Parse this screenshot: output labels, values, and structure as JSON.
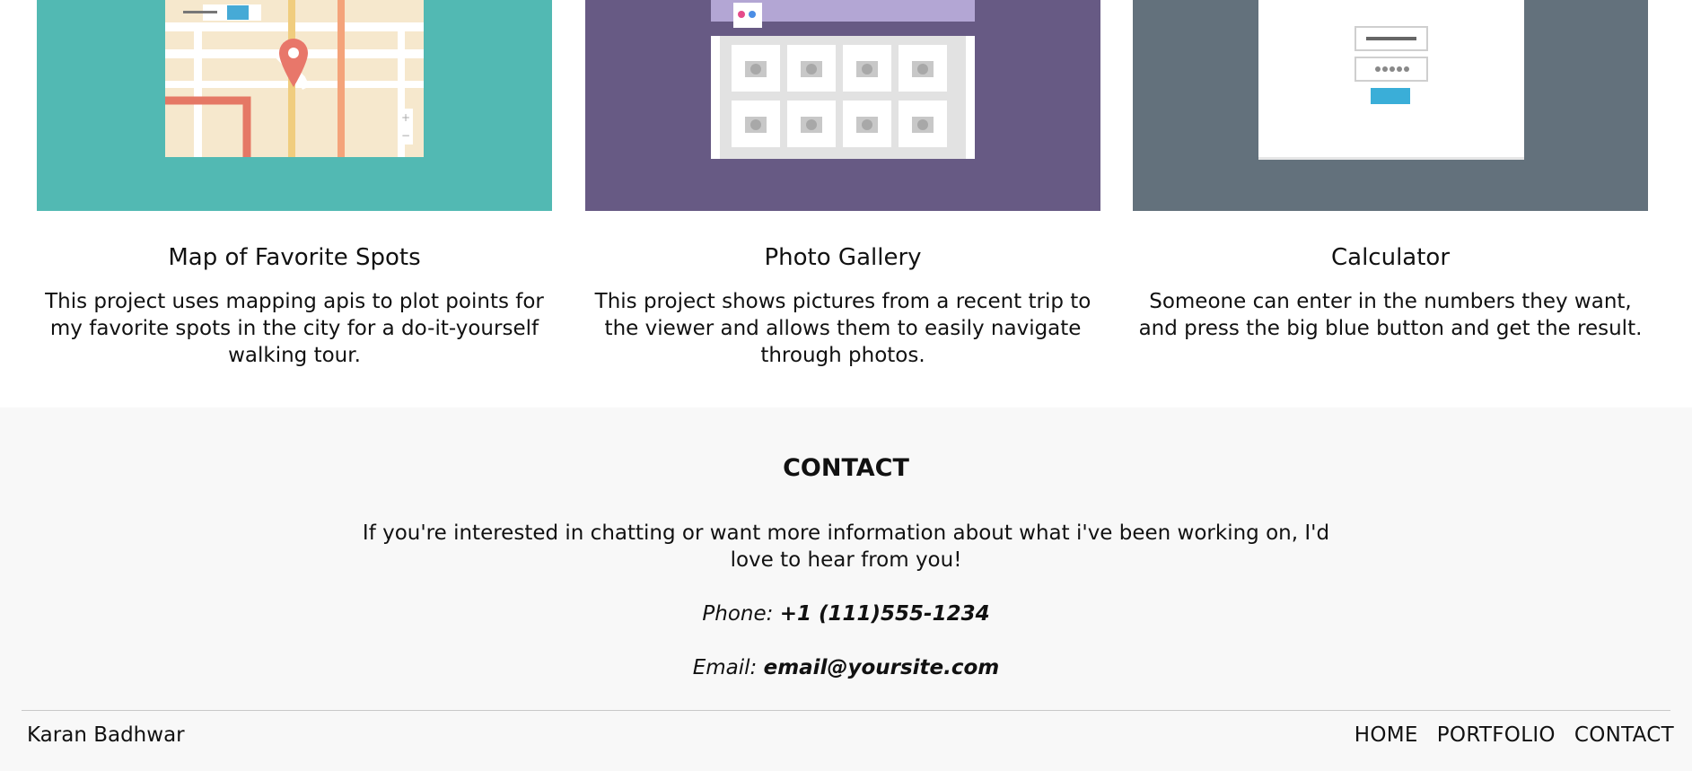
{
  "projects": [
    {
      "title": "Map of Favorite Spots",
      "description": "This project uses mapping apis to plot points for my favorite spots in the city for a do-it-yourself walking tour.",
      "thumb_icon": "map-illustration",
      "thumb_color": "#52b9b3"
    },
    {
      "title": "Photo Gallery",
      "description": "This project shows pictures from a recent trip to the viewer and allows them to easily navigate through photos.",
      "thumb_icon": "gallery-illustration",
      "thumb_color": "#675a84"
    },
    {
      "title": "Calculator",
      "description": "Someone can enter in the numbers they want, and press the big blue button and get the result.",
      "thumb_icon": "login-form-illustration",
      "thumb_color": "#63717c"
    }
  ],
  "contact": {
    "heading": "CONTACT",
    "text": "If you're interested in chatting or want more information about what i've been working on, I'd love to hear from you!",
    "phone_label": "Phone: ",
    "phone_value": "+1 (111)555-1234",
    "email_label": "Email: ",
    "email_value": "email@yoursite.com"
  },
  "footer": {
    "brand": "Karan Badhwar",
    "nav": [
      "HOME",
      "PORTFOLIO",
      "CONTACT"
    ]
  }
}
